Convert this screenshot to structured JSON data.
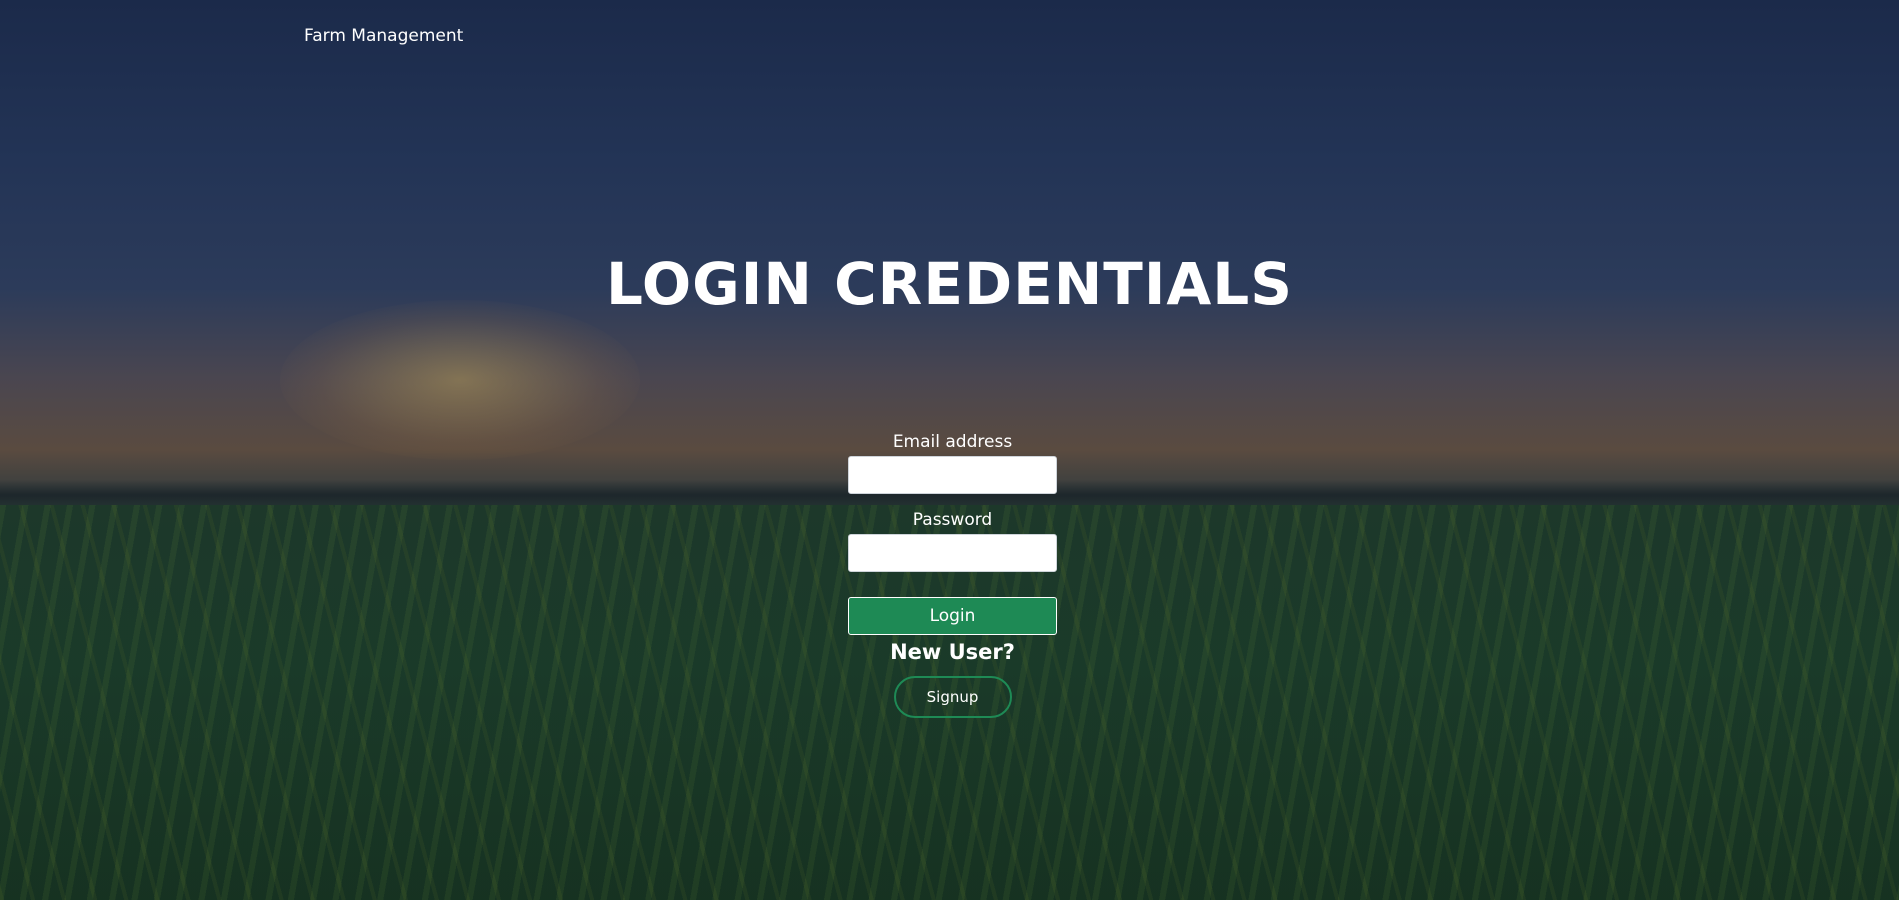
{
  "header": {
    "brand": "Farm Management"
  },
  "main": {
    "title": "LOGIN CREDENTIALS"
  },
  "form": {
    "email_label": "Email address",
    "email_value": "",
    "password_label": "Password",
    "password_value": "",
    "login_label": "Login",
    "new_user_text": "New User?",
    "signup_label": "Signup"
  },
  "colors": {
    "primary_green": "#1e8a55",
    "text": "#ffffff"
  }
}
